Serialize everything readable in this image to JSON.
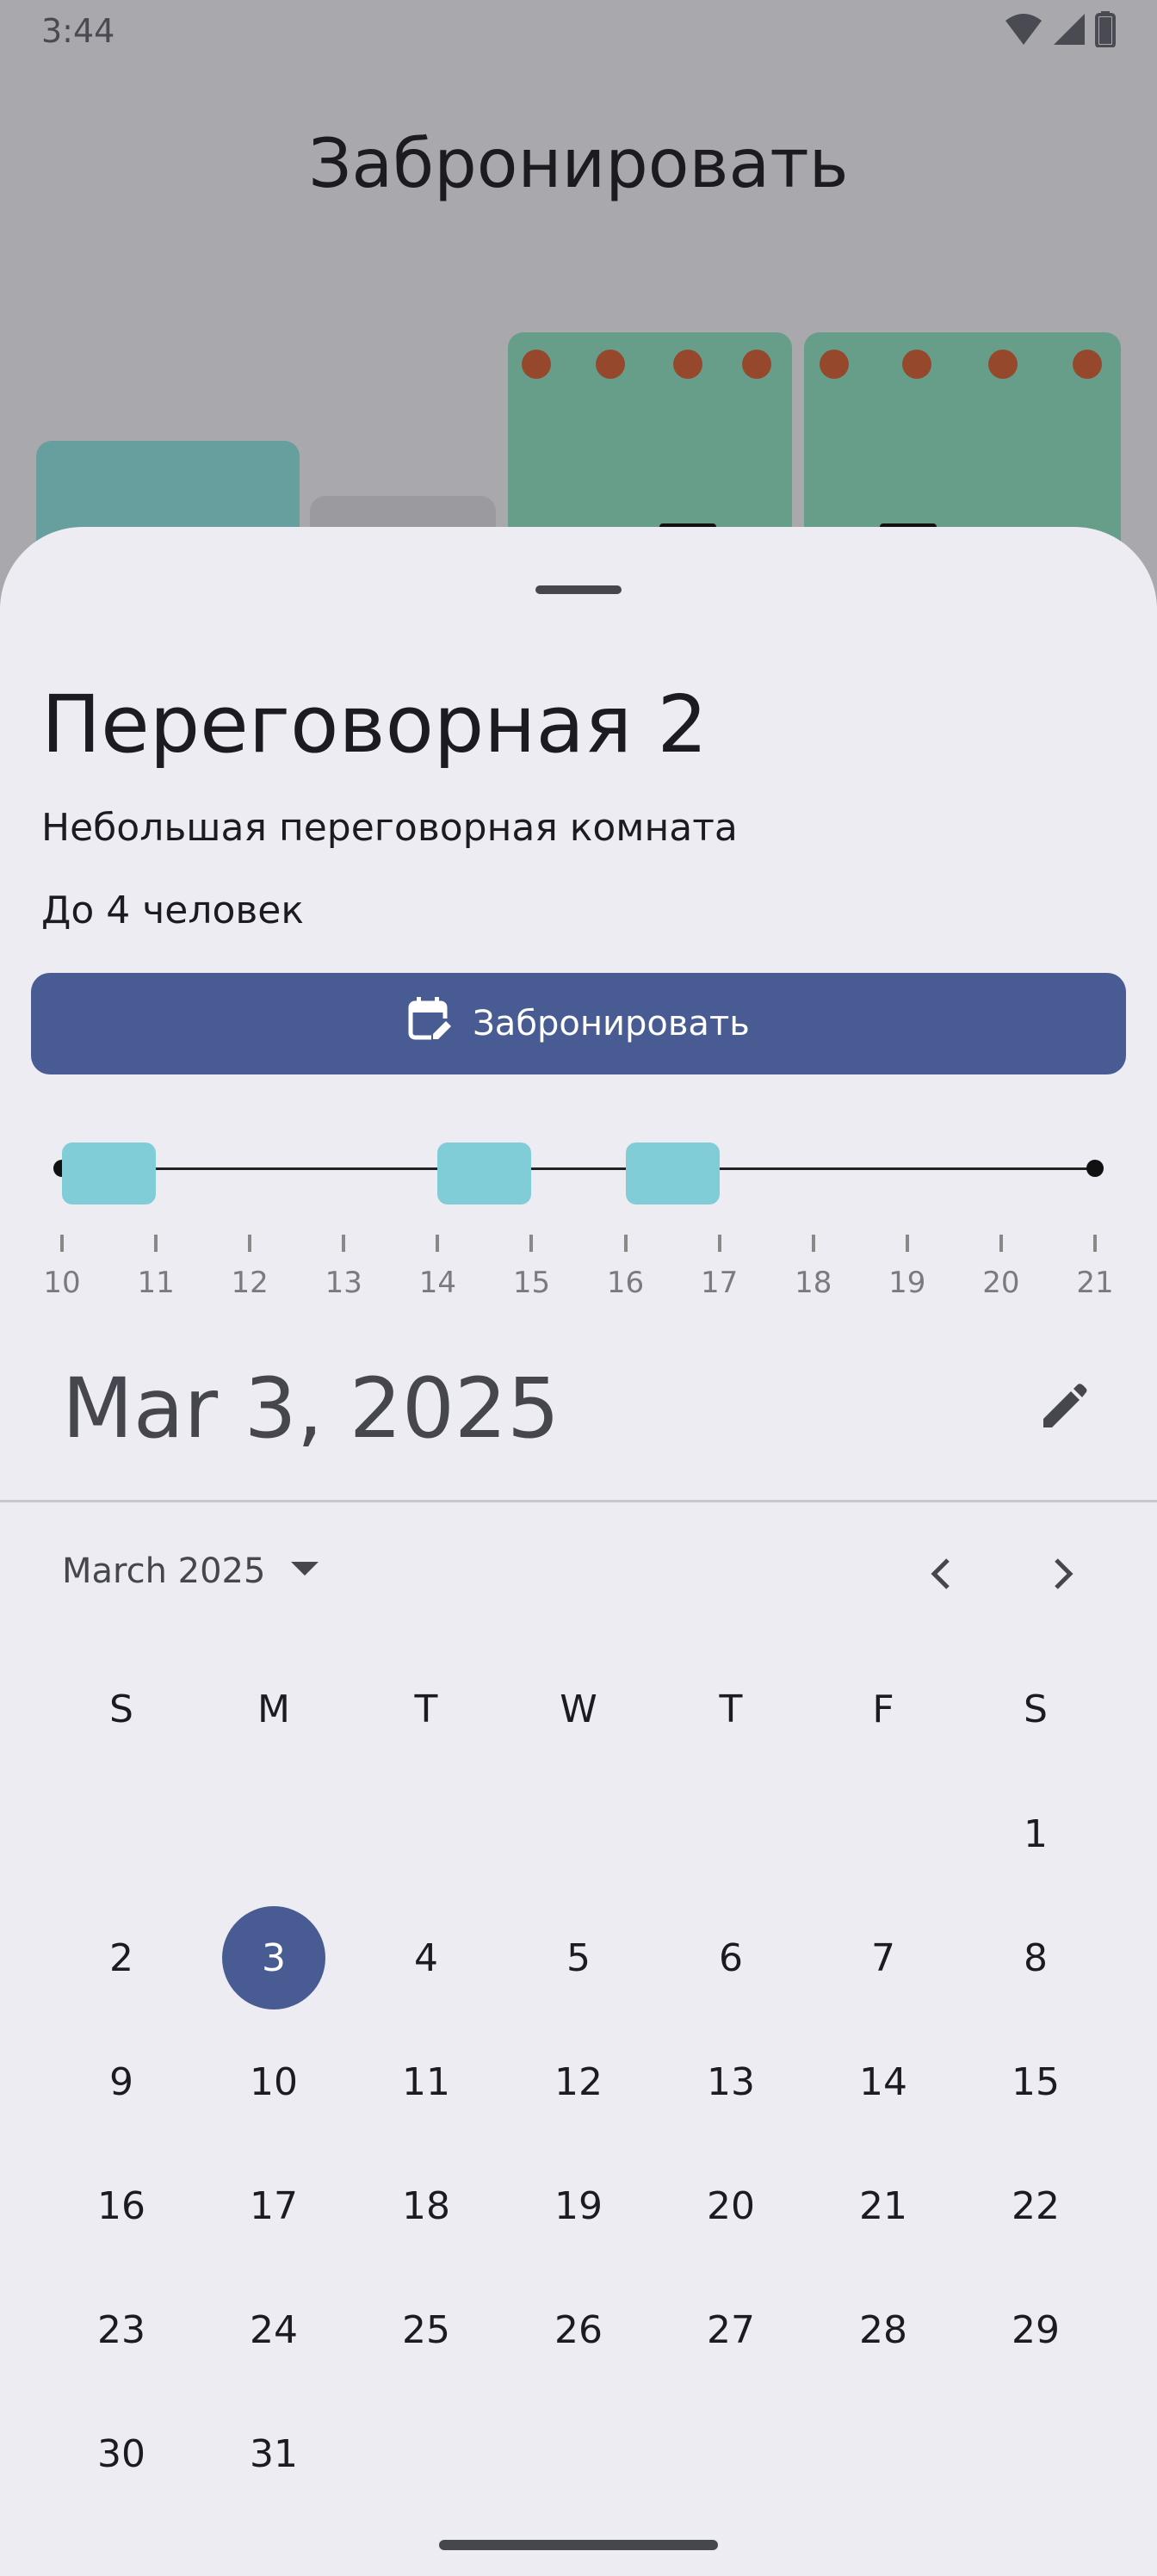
{
  "status": {
    "time": "3:44"
  },
  "page": {
    "title": "Забронировать"
  },
  "room": {
    "name": "Переговорная 2",
    "description": "Небольшая переговорная комната",
    "capacity": "До 4 человек",
    "book_label": "Забронировать"
  },
  "timeline": {
    "hours": [
      "10",
      "11",
      "12",
      "13",
      "14",
      "15",
      "16",
      "17",
      "18",
      "19",
      "20",
      "21"
    ],
    "booked_ranges": [
      [
        10,
        11
      ],
      [
        14,
        15
      ],
      [
        16,
        17
      ]
    ]
  },
  "date": {
    "selected_display": "Mar 3, 2025",
    "month_label": "March 2025",
    "weekdays": [
      "S",
      "M",
      "T",
      "W",
      "T",
      "F",
      "S"
    ],
    "days": [
      "1",
      "2",
      "3",
      "4",
      "5",
      "6",
      "7",
      "8",
      "9",
      "10",
      "11",
      "12",
      "13",
      "14",
      "15",
      "16",
      "17",
      "18",
      "19",
      "20",
      "21",
      "22",
      "23",
      "24",
      "25",
      "26",
      "27",
      "28",
      "29",
      "30",
      "31"
    ],
    "first_weekday_index": 6,
    "selected_day": "3"
  },
  "colors": {
    "accent": "#485c93",
    "booked": "#80cdd7",
    "sheet": "#edecf3",
    "room_green": "#669e89",
    "room_teal": "#679e9e",
    "seat_dot": "#96482d"
  }
}
